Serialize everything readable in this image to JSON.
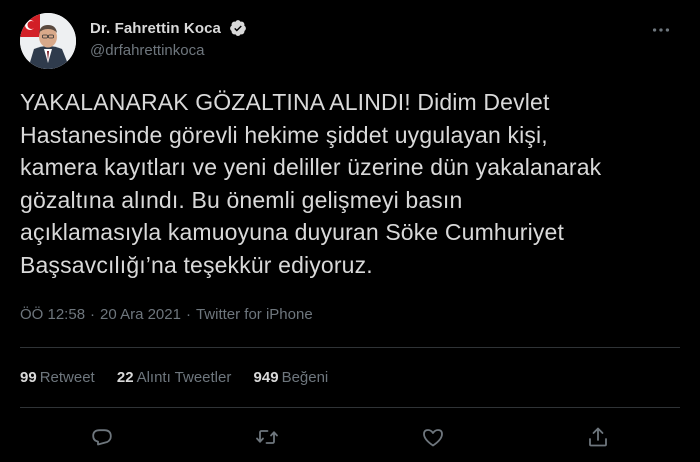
{
  "author": {
    "display_name": "Dr. Fahrettin Koca",
    "handle": "@drfahrettinkoca",
    "verified_icon": "verified-badge-icon"
  },
  "tweet": {
    "text_lines": [
      "YAKALANARAK GÖZALTINA ALINDI! Didim Devlet",
      "Hastanesinde görevli hekime şiddet uygulayan kişi,",
      "kamera kayıtları ve yeni deliller üzerine dün yakalanarak",
      "gözaltına alındı. Bu önemli gelişmeyi basın",
      "açıklamasıyla kamuoyuna duyuran Söke Cumhuriyet",
      "Başsavcılığı’na teşekkür ediyoruz."
    ],
    "time": "ÖÖ 12:58",
    "separator": "·",
    "date": "20 Ara 2021",
    "source": "Twitter for iPhone"
  },
  "stats": {
    "retweets_count": "99",
    "retweets_label": "Retweet",
    "quotes_count": "22",
    "quotes_label": "Alıntı Tweetler",
    "likes_count": "949",
    "likes_label": "Beğeni"
  },
  "actions": [
    "reply-icon",
    "retweet-icon",
    "like-icon",
    "share-icon"
  ],
  "colors": {
    "background": "#000000",
    "text": "#d9d9d9",
    "secondary": "#6e767d",
    "divider": "#2f3336",
    "verified": "#d9d9d9"
  }
}
